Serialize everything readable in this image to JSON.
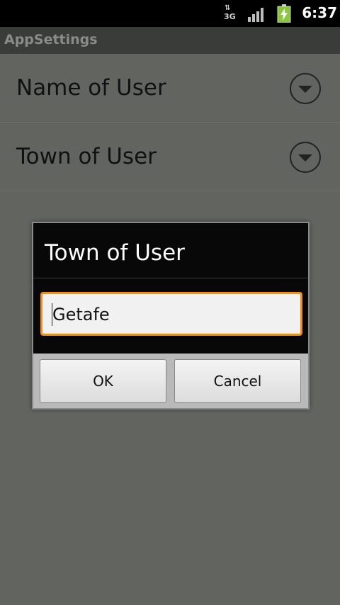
{
  "status_bar": {
    "network_type": "3G",
    "network_arrows": "⇅",
    "time": "6:37",
    "icons": [
      "data-activity-icon",
      "signal-strength-icon",
      "battery-charging-icon"
    ]
  },
  "app": {
    "title": "AppSettings"
  },
  "preferences": [
    {
      "label": "Name of User",
      "icon": "chevron-down-icon"
    },
    {
      "label": "Town of User",
      "icon": "chevron-down-icon"
    }
  ],
  "dialog": {
    "title": "Town of User",
    "input_value": "Getafe",
    "ok_label": "OK",
    "cancel_label": "Cancel"
  },
  "colors": {
    "focus_border": "#f0900e",
    "battery_green": "#8cc63f",
    "background": "#626460"
  }
}
